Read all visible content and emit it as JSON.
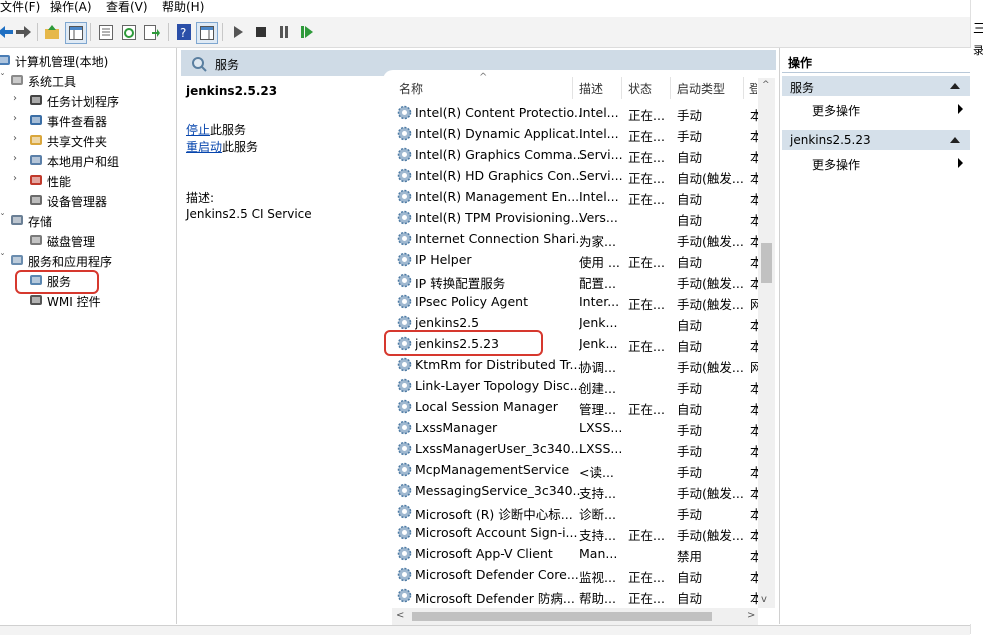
{
  "menu": [
    "文件(F)",
    "操作(A)",
    "查看(V)",
    "帮助(H)"
  ],
  "edge_glyphs": [
    "三",
    "录"
  ],
  "tree": {
    "items": [
      {
        "label": "计算机管理(本地)",
        "icon": "computer-manage-icon",
        "expander": ""
      },
      {
        "label": "系统工具",
        "icon": "tools-icon",
        "expander": "v"
      },
      {
        "label": "任务计划程序",
        "icon": "clock-icon",
        "expander": ">"
      },
      {
        "label": "事件查看器",
        "icon": "event-viewer-icon",
        "expander": ">"
      },
      {
        "label": "共享文件夹",
        "icon": "shared-folder-icon",
        "expander": ">"
      },
      {
        "label": "本地用户和组",
        "icon": "users-icon",
        "expander": ">"
      },
      {
        "label": "性能",
        "icon": "performance-icon",
        "expander": ">"
      },
      {
        "label": "设备管理器",
        "icon": "device-manager-icon",
        "expander": ""
      },
      {
        "label": "存储",
        "icon": "storage-icon",
        "expander": "v"
      },
      {
        "label": "磁盘管理",
        "icon": "disk-icon",
        "expander": ""
      },
      {
        "label": "服务和应用程序",
        "icon": "services-apps-icon",
        "expander": "v"
      },
      {
        "label": "服务",
        "icon": "gear-icon",
        "expander": ""
      },
      {
        "label": "WMI 控件",
        "icon": "wmi-icon",
        "expander": ""
      }
    ]
  },
  "center": {
    "header_title": "服务",
    "selected_service": "jenkins2.5.23",
    "stop_link": "停止",
    "stop_suffix": "此服务",
    "restart_link": "重启动",
    "restart_suffix": "此服务",
    "desc_label": "描述:",
    "desc_text": "Jenkins2.5 CI Service"
  },
  "columns": [
    "名称",
    "描述",
    "状态",
    "启动类型",
    "登"
  ],
  "services": [
    {
      "name": "Intel(R) Content Protectio...",
      "desc": "Intel...",
      "status": "正在...",
      "startup": "手动",
      "logon": "本"
    },
    {
      "name": "Intel(R) Dynamic Applicat...",
      "desc": "Intel...",
      "status": "正在...",
      "startup": "手动",
      "logon": "本"
    },
    {
      "name": "Intel(R) Graphics Comma...",
      "desc": "Servi...",
      "status": "正在...",
      "startup": "自动",
      "logon": "本"
    },
    {
      "name": "Intel(R) HD Graphics Con...",
      "desc": "Servi...",
      "status": "正在...",
      "startup": "自动(触发...",
      "logon": "本"
    },
    {
      "name": "Intel(R) Management En...",
      "desc": "Intel...",
      "status": "正在...",
      "startup": "自动",
      "logon": "本"
    },
    {
      "name": "Intel(R) TPM Provisioning...",
      "desc": "Vers...",
      "status": "",
      "startup": "自动",
      "logon": "本"
    },
    {
      "name": "Internet Connection Shari...",
      "desc": "为家...",
      "status": "",
      "startup": "手动(触发...",
      "logon": "本"
    },
    {
      "name": "IP Helper",
      "desc": "使用 ...",
      "status": "正在...",
      "startup": "自动",
      "logon": "本"
    },
    {
      "name": "IP 转换配置服务",
      "desc": "配置...",
      "status": "",
      "startup": "手动(触发...",
      "logon": "本"
    },
    {
      "name": "IPsec Policy Agent",
      "desc": "Inter...",
      "status": "正在...",
      "startup": "手动(触发...",
      "logon": "网"
    },
    {
      "name": "jenkins2.5",
      "desc": "Jenk...",
      "status": "",
      "startup": "自动",
      "logon": "本"
    },
    {
      "name": "jenkins2.5.23",
      "desc": "Jenk...",
      "status": "正在...",
      "startup": "自动",
      "logon": "本"
    },
    {
      "name": "KtmRm for Distributed Tr...",
      "desc": "协调...",
      "status": "",
      "startup": "手动(触发...",
      "logon": "网"
    },
    {
      "name": "Link-Layer Topology Disc...",
      "desc": "创建...",
      "status": "",
      "startup": "手动",
      "logon": "本"
    },
    {
      "name": "Local Session Manager",
      "desc": "管理...",
      "status": "正在...",
      "startup": "自动",
      "logon": "本"
    },
    {
      "name": "LxssManager",
      "desc": "LXSS...",
      "status": "",
      "startup": "手动",
      "logon": "本"
    },
    {
      "name": "LxssManagerUser_3c340...",
      "desc": "LXSS...",
      "status": "",
      "startup": "手动",
      "logon": "本"
    },
    {
      "name": "McpManagementService",
      "desc": "<读...",
      "status": "",
      "startup": "手动",
      "logon": "本"
    },
    {
      "name": "MessagingService_3c340...",
      "desc": "支持...",
      "status": "",
      "startup": "手动(触发...",
      "logon": "本"
    },
    {
      "name": "Microsoft (R) 诊断中心标...",
      "desc": "诊断...",
      "status": "",
      "startup": "手动",
      "logon": "本"
    },
    {
      "name": "Microsoft Account Sign-i...",
      "desc": "支持...",
      "status": "正在...",
      "startup": "手动(触发...",
      "logon": "本"
    },
    {
      "name": "Microsoft App-V Client",
      "desc": "Man...",
      "status": "",
      "startup": "禁用",
      "logon": "本"
    },
    {
      "name": "Microsoft Defender Core...",
      "desc": "监视...",
      "status": "正在...",
      "startup": "自动",
      "logon": "本"
    },
    {
      "name": "Microsoft Defender 防病...",
      "desc": "帮助...",
      "status": "正在...",
      "startup": "自动",
      "logon": "本"
    }
  ],
  "actions": {
    "title": "操作",
    "groups": [
      {
        "title": "服务",
        "item": "更多操作"
      },
      {
        "title": "jenkins2.5.23",
        "item": "更多操作"
      }
    ]
  },
  "colors": {
    "highlight": "#d6382e",
    "header_bg": "#cfdbe6",
    "action_head_bg": "#d5e0ea",
    "link": "#0645ad"
  }
}
